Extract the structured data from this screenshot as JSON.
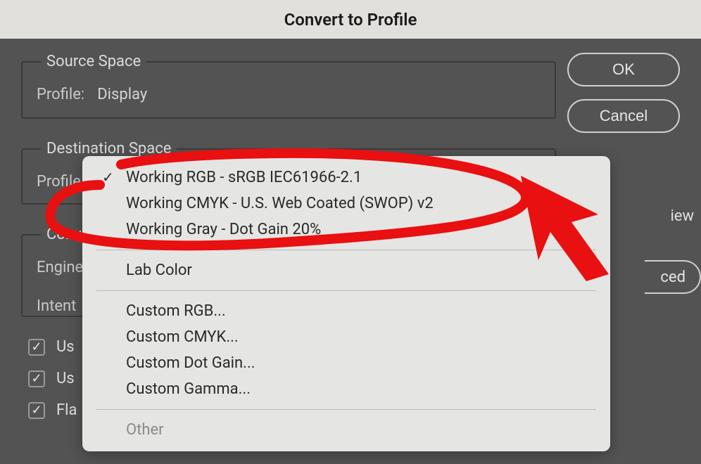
{
  "dialog": {
    "title": "Convert to Profile"
  },
  "source_space": {
    "legend": "Source Space",
    "profile_label": "Profile:",
    "profile_value": "Display"
  },
  "destination_space": {
    "legend": "Destination Space",
    "profile_label": "Profile"
  },
  "conversion_options": {
    "legend": "Conv",
    "engine_label": "Engine",
    "intent_label": "Intent"
  },
  "buttons": {
    "ok": "OK",
    "cancel": "Cancel",
    "preview_partial": "iew",
    "advanced_partial": "ced"
  },
  "checkboxes": {
    "use1": {
      "checked": true,
      "label_partial": "Us"
    },
    "use2": {
      "checked": true,
      "label_partial": "Us"
    },
    "flatten": {
      "checked": true,
      "label_partial": "Fla"
    }
  },
  "dropdown": {
    "items": [
      {
        "label": "Working RGB - sRGB IEC61966-2.1",
        "checked": true
      },
      {
        "label": "Working CMYK - U.S. Web Coated (SWOP) v2",
        "checked": false
      },
      {
        "label": "Working Gray - Dot Gain 20%",
        "checked": false
      }
    ],
    "lab": "Lab Color",
    "custom": [
      "Custom RGB...",
      "Custom CMYK...",
      "Custom Dot Gain...",
      "Custom Gamma..."
    ],
    "other": "Other"
  }
}
